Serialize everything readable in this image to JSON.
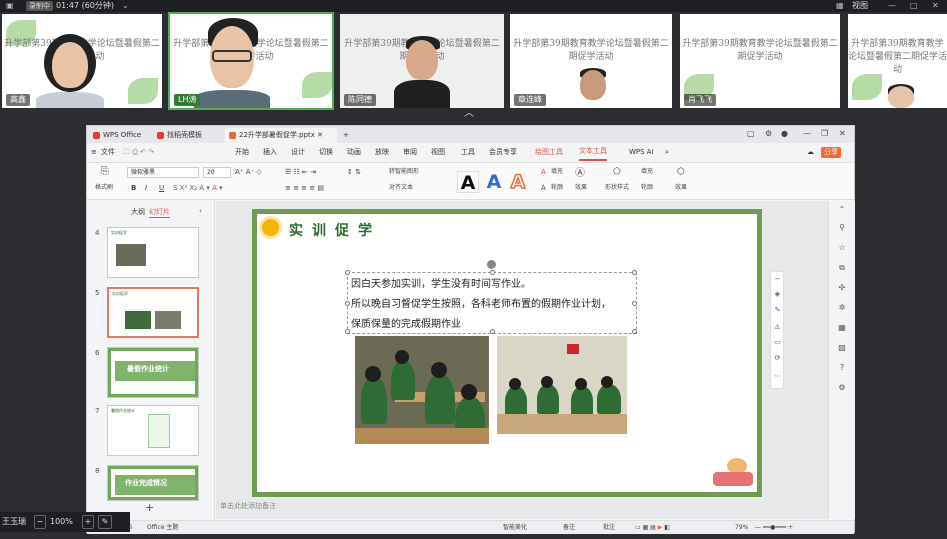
{
  "topbar": {
    "recording_badge": "录制中",
    "timer": "01:47 (60分钟)",
    "view_label": "视图",
    "icons": [
      "minimize-icon",
      "maximize-icon",
      "close-icon"
    ]
  },
  "participants": [
    {
      "name": "高鑫",
      "slide_title": "升学部第39期教育教学论坛暨暑假第二期促学活动",
      "cam": "female"
    },
    {
      "name": "LH涛",
      "slide_title": "升学部第39期教育教学论坛暨暑假第二期促学活动",
      "cam": "male-glasses"
    },
    {
      "name": "陈同德",
      "slide_title": "升学部第39期教育教学论坛暨暑假第二期促学活动",
      "cam": "male-dark"
    },
    {
      "name": "章连峰",
      "slide_title": "升学部第39期教育教学论坛暨暑假第二期促学活动",
      "cam": "male-slide"
    },
    {
      "name": "肖飞飞",
      "slide_title": "升学部第39期教育教学论坛暨暑假第二期促学活动",
      "cam": "none"
    },
    {
      "name": "",
      "slide_title": "升学部第39期教育教学论坛暨暑假第二期促学活动",
      "cam": "partial"
    }
  ],
  "wps": {
    "tabs": [
      {
        "label": "WPS Office"
      },
      {
        "label": "找稻壳模板"
      },
      {
        "label": "22升学部暑假促学.pptx"
      }
    ],
    "new_tab": "+",
    "menu": [
      "文件",
      "开始",
      "插入",
      "设计",
      "切换",
      "动画",
      "放映",
      "审阅",
      "视图",
      "工具",
      "会员专享",
      "绘图工具",
      "文本工具",
      "WPS AI"
    ],
    "ribbon": {
      "format_painter": "格式刷",
      "font": "微软雅黑",
      "size": "20",
      "buttons_b": "B",
      "buttons_i": "I",
      "buttons_u": "U",
      "convert_smartart": "转智能图形",
      "text_to_frame": "对齐文本",
      "fill": "填充",
      "outline": "轮廓",
      "effects": "效果",
      "shape_styles": "形状样式",
      "fill2": "填充",
      "outline2": "轮廓",
      "effects2": "效果"
    },
    "left_panel": {
      "tab_outline": "大纲",
      "tab_slides": "幻灯片",
      "add": "+"
    },
    "thumbnails": [
      {
        "num": "4",
        "title": "实训促学"
      },
      {
        "num": "5",
        "title": "实训促学",
        "selected": true
      },
      {
        "num": "6",
        "title": "暑假作业统计"
      },
      {
        "num": "7",
        "title": "暑假作业统计"
      },
      {
        "num": "8",
        "title": "作业完成情况"
      }
    ],
    "slide": {
      "title": "实训促学",
      "lines": [
        "因白天参加实训，学生没有时间写作业。",
        "所以晚自习督促学生按照，各科老师布置的假期作业计划，",
        "保质保量的完成假期作业"
      ]
    },
    "notes_placeholder": "单击此处添加备注",
    "status": {
      "page": "5 / 16",
      "theme": "Office 主题",
      "beautify": "智能美化",
      "notes": "备注",
      "comments": "批注",
      "zoom": "79%"
    }
  },
  "meeting_bottom": {
    "name_label": "王玉瑞",
    "zoom": "100%",
    "minus": "−",
    "plus": "+"
  }
}
